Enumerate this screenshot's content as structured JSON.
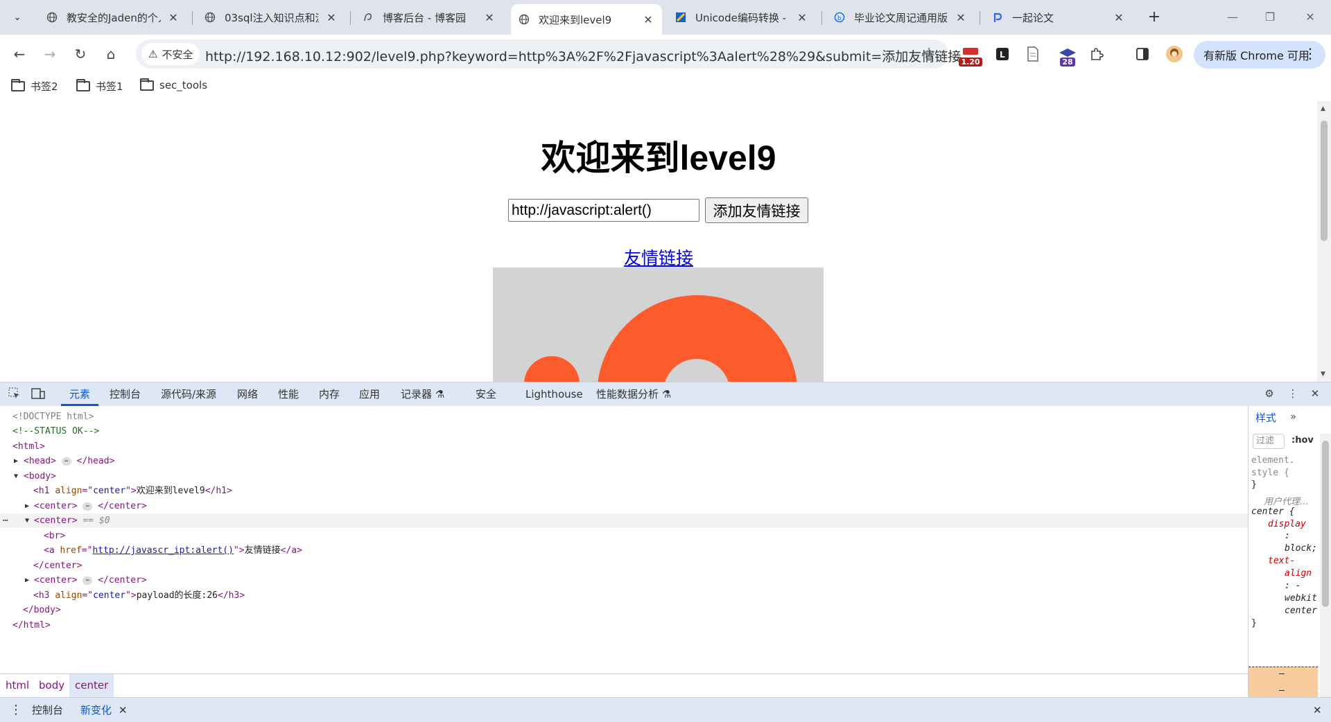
{
  "browser": {
    "tabs": [
      {
        "title": "教安全的Jaden的个人",
        "favicon": "globe-icon",
        "active": false
      },
      {
        "title": "03sql注入知识点和流",
        "favicon": "globe-icon",
        "active": false
      },
      {
        "title": "博客后台 - 博客园",
        "favicon": "cnblogs-icon",
        "active": false
      },
      {
        "title": "欢迎来到level9",
        "favicon": "globe-icon",
        "active": true
      },
      {
        "title": "Unicode编码转换 - ",
        "favicon": "unicode-icon",
        "active": false
      },
      {
        "title": "毕业论文周记通用版",
        "favicon": "bing-icon",
        "active": false
      },
      {
        "title": "一起论文",
        "favicon": "p-icon",
        "active": false
      }
    ],
    "security_label": "不安全",
    "url": "http://192.168.10.12:902/level9.php?keyword=http%3A%2F%2Fjavascript%3Aalert%28%29&submit=添加友情链接",
    "extensions": {
      "badge1": "1.20",
      "badge2": "28"
    },
    "update_label": "有新版 Chrome 可用",
    "bookmarks": [
      "书签2",
      "书签1",
      "sec_tools"
    ]
  },
  "page": {
    "heading": "欢迎来到level9",
    "input_value": "http://javascript:alert()",
    "submit_label": "添加友情链接",
    "link_text": "友情链接"
  },
  "devtools": {
    "tabs": [
      "元素",
      "控制台",
      "源代码/来源",
      "网络",
      "性能",
      "内存",
      "应用",
      "记录器",
      "安全",
      "Lighthouse",
      "性能数据分析"
    ],
    "dom": {
      "doctype": "<!DOCTYPE html>",
      "comment": "<!--STATUS OK-->",
      "h1_text": "欢迎来到level9",
      "href": "http://javascr_ipt:alert()",
      "a_text": "友情链接",
      "h3_text": "payload的长度:26",
      "selected_marker": "== $0"
    },
    "styles": {
      "tab": "样式",
      "filter_placeholder": "过滤",
      "hov": ":hov",
      "element_style_1": "element.",
      "element_style_2": "style {",
      "close_brace": "}",
      "ua_label": "用户代理…",
      "selector": "center {",
      "prop_display": "display",
      "val_display": "block;",
      "prop_text_align_1": "text-",
      "prop_text_align_2": "align",
      "val_text_align_1": ": -",
      "val_text_align_2": "webkit",
      "val_text_align_3": "center",
      "colon": ":",
      "dash": "–"
    },
    "breadcrumbs": [
      "html",
      "body",
      "center"
    ],
    "drawer": {
      "console": "控制台",
      "changes": "新变化"
    }
  }
}
